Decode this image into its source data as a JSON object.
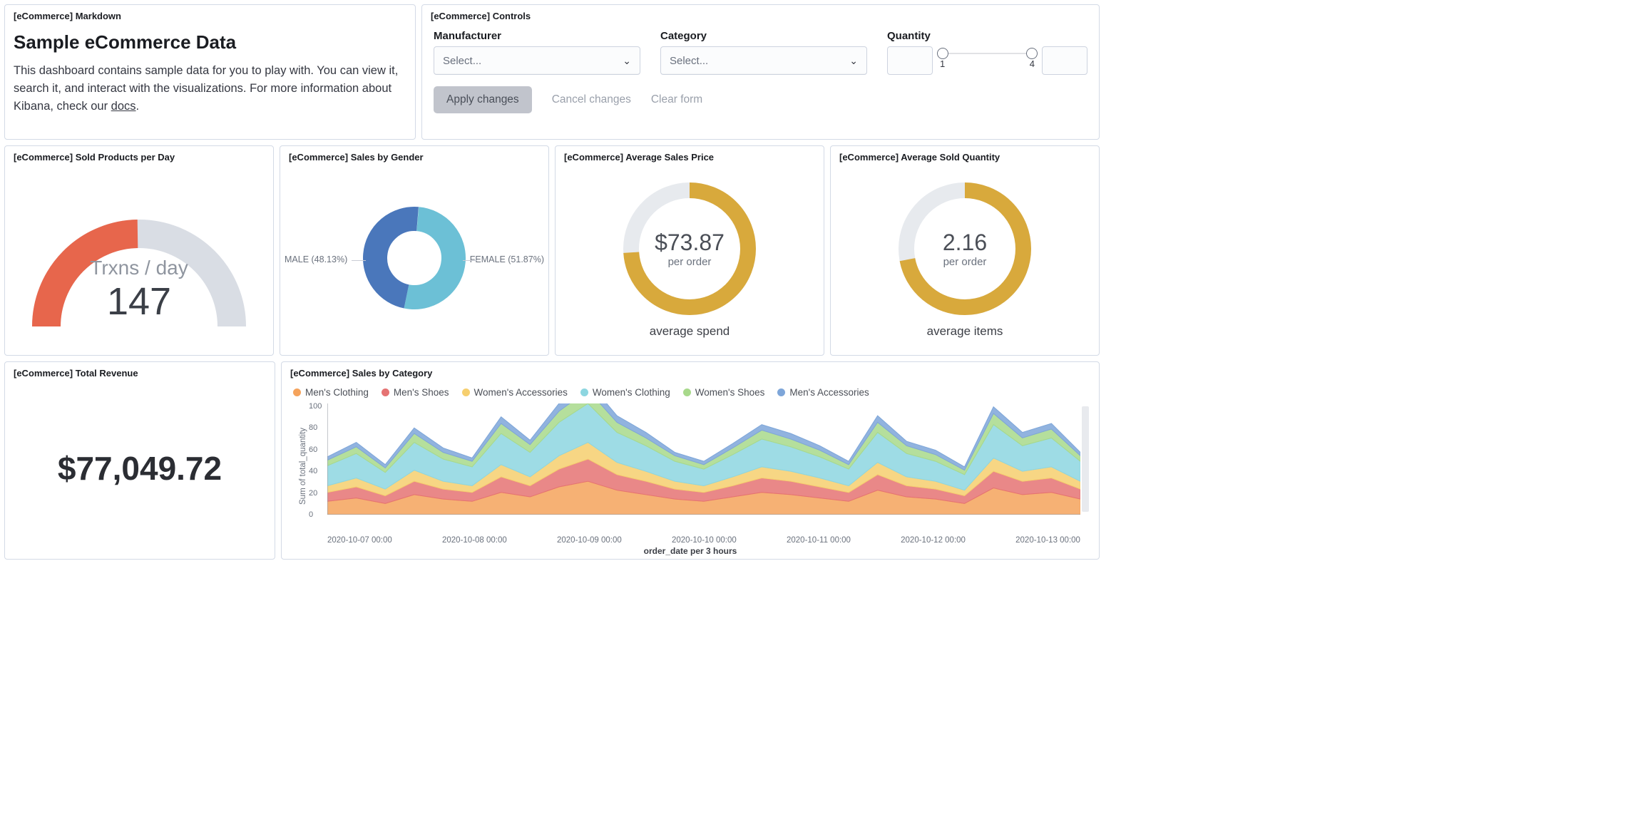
{
  "markdown_panel": {
    "title": "[eCommerce] Markdown",
    "heading": "Sample eCommerce Data",
    "body_text": "This dashboard contains sample data for you to play with. You can view it, search it, and interact with the visualizations. For more information about Kibana, check our ",
    "docs_link_text": "docs",
    "body_after": "."
  },
  "controls_panel": {
    "title": "[eCommerce] Controls",
    "manufacturer_label": "Manufacturer",
    "manufacturer_placeholder": "Select...",
    "category_label": "Category",
    "category_placeholder": "Select...",
    "quantity_label": "Quantity",
    "quantity_min": "1",
    "quantity_max": "4",
    "apply_button": "Apply changes",
    "cancel_button": "Cancel changes",
    "clear_button": "Clear form"
  },
  "sold_panel": {
    "title": "[eCommerce] Sold Products per Day",
    "label": "Trxns / day",
    "value": "147"
  },
  "gender_panel": {
    "title": "[eCommerce] Sales by Gender",
    "male_label": "MALE (48.13%)",
    "female_label": "FEMALE (51.87%)"
  },
  "avg_price_panel": {
    "title": "[eCommerce] Average Sales Price",
    "value": "$73.87",
    "sub": "per order",
    "caption": "average spend"
  },
  "avg_qty_panel": {
    "title": "[eCommerce] Average Sold Quantity",
    "value": "2.16",
    "sub": "per order",
    "caption": "average items"
  },
  "revenue_panel": {
    "title": "[eCommerce] Total Revenue",
    "value": "$77,049.72"
  },
  "category_panel": {
    "title": "[eCommerce] Sales by Category",
    "legend": [
      {
        "label": "Men's Clothing",
        "color": "#f5a35c"
      },
      {
        "label": "Men's Shoes",
        "color": "#e57373"
      },
      {
        "label": "Women's Accessories",
        "color": "#f6cf6f"
      },
      {
        "label": "Women's Clothing",
        "color": "#8dd6e0"
      },
      {
        "label": "Women's Shoes",
        "color": "#a8d98b"
      },
      {
        "label": "Men's Accessories",
        "color": "#7ea6d9"
      }
    ],
    "ylabel": "Sum of total_quantity",
    "xlabel": "order_date per 3 hours",
    "x_ticks": [
      "2020-10-07 00:00",
      "2020-10-08 00:00",
      "2020-10-09 00:00",
      "2020-10-10 00:00",
      "2020-10-11 00:00",
      "2020-10-12 00:00",
      "2020-10-13 00:00"
    ],
    "y_ticks": [
      "100",
      "80",
      "60",
      "40",
      "20",
      "0"
    ]
  },
  "chart_data": [
    {
      "type": "gauge",
      "title": "[eCommerce] Sold Products per Day",
      "label": "Trxns / day",
      "value": 147,
      "min": 0,
      "max": 300,
      "fraction": 0.49,
      "color": "#e7664c"
    },
    {
      "type": "pie",
      "title": "[eCommerce] Sales by Gender",
      "series": [
        {
          "name": "FEMALE",
          "value": 51.87,
          "color": "#6cc0d6"
        },
        {
          "name": "MALE",
          "value": 48.13,
          "color": "#4a77bb"
        }
      ]
    },
    {
      "type": "goal_donut",
      "title": "[eCommerce] Average Sales Price",
      "value": 73.87,
      "display": "$73.87",
      "target": 100,
      "fraction": 0.74,
      "color": "#d8a93c",
      "caption": "average spend"
    },
    {
      "type": "goal_donut",
      "title": "[eCommerce] Average Sold Quantity",
      "value": 2.16,
      "display": "2.16",
      "target": 3,
      "fraction": 0.72,
      "color": "#d8a93c",
      "caption": "average items"
    },
    {
      "type": "metric",
      "title": "[eCommerce] Total Revenue",
      "value": 77049.72,
      "display": "$77,049.72"
    },
    {
      "type": "area",
      "title": "[eCommerce] Sales by Category",
      "xlabel": "order_date per 3 hours",
      "ylabel": "Sum of total_quantity",
      "ylim": [
        0,
        100
      ],
      "x": [
        "2020-10-06 18:00",
        "2020-10-07 00:00",
        "2020-10-07 06:00",
        "2020-10-07 12:00",
        "2020-10-07 18:00",
        "2020-10-08 00:00",
        "2020-10-08 06:00",
        "2020-10-08 12:00",
        "2020-10-08 18:00",
        "2020-10-09 00:00",
        "2020-10-09 06:00",
        "2020-10-09 12:00",
        "2020-10-09 18:00",
        "2020-10-10 00:00",
        "2020-10-10 06:00",
        "2020-10-10 12:00",
        "2020-10-10 18:00",
        "2020-10-11 00:00",
        "2020-10-11 06:00",
        "2020-10-11 12:00",
        "2020-10-11 18:00",
        "2020-10-12 00:00",
        "2020-10-12 06:00",
        "2020-10-12 12:00",
        "2020-10-12 18:00",
        "2020-10-13 00:00",
        "2020-10-13 06:00"
      ],
      "series": [
        {
          "name": "Men's Clothing",
          "color": "#f5a35c",
          "values": [
            12,
            15,
            10,
            18,
            14,
            12,
            20,
            16,
            25,
            30,
            22,
            18,
            14,
            12,
            16,
            20,
            18,
            15,
            12,
            22,
            16,
            14,
            10,
            24,
            18,
            20,
            14
          ]
        },
        {
          "name": "Men's Shoes",
          "color": "#e57373",
          "values": [
            8,
            10,
            7,
            12,
            9,
            8,
            14,
            10,
            16,
            20,
            14,
            12,
            9,
            8,
            10,
            13,
            12,
            10,
            8,
            14,
            10,
            9,
            7,
            15,
            12,
            13,
            9
          ]
        },
        {
          "name": "Women's Accessories",
          "color": "#f6cf6f",
          "values": [
            6,
            8,
            6,
            10,
            7,
            6,
            11,
            8,
            12,
            15,
            11,
            9,
            7,
            6,
            8,
            10,
            9,
            8,
            6,
            11,
            8,
            7,
            5,
            12,
            9,
            10,
            7
          ]
        },
        {
          "name": "Women's Clothing",
          "color": "#8dd6e0",
          "values": [
            18,
            22,
            15,
            25,
            20,
            17,
            28,
            22,
            30,
            35,
            27,
            23,
            18,
            15,
            20,
            25,
            22,
            19,
            15,
            27,
            21,
            18,
            14,
            30,
            23,
            26,
            18
          ]
        },
        {
          "name": "Women's Shoes",
          "color": "#a8d98b",
          "values": [
            5,
            6,
            4,
            8,
            6,
            5,
            9,
            7,
            10,
            12,
            9,
            7,
            5,
            4,
            6,
            8,
            7,
            6,
            4,
            9,
            7,
            6,
            4,
            10,
            7,
            8,
            5
          ]
        },
        {
          "name": "Men's Accessories",
          "color": "#7ea6d9",
          "values": [
            3,
            4,
            3,
            5,
            4,
            3,
            6,
            4,
            7,
            8,
            6,
            5,
            3,
            3,
            4,
            5,
            5,
            4,
            3,
            6,
            4,
            4,
            3,
            6,
            5,
            5,
            3
          ]
        }
      ]
    }
  ]
}
